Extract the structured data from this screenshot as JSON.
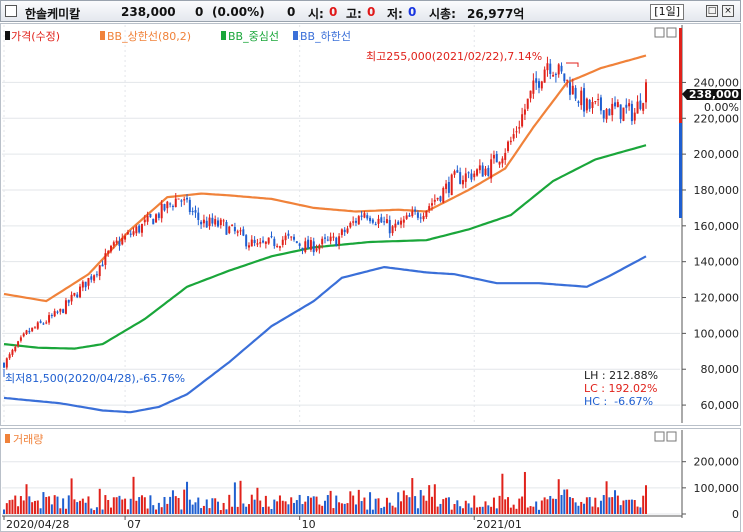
{
  "header": {
    "stock_name": "한솔케미칼",
    "price": "238,000",
    "change": "0",
    "change_pct": "(0.00%)",
    "volume": "0",
    "open_label": "시:",
    "open_value": "0",
    "high_label": "고:",
    "high_value": "0",
    "low_label": "저:",
    "low_value": "0",
    "mcap_label": "시총:",
    "mcap_value": "26,977억",
    "period": "[1일]"
  },
  "legend": {
    "price": "가격(수정)",
    "upper": "BB_상한선(80,2)",
    "middle": "BB_중심선",
    "lower": "BB_하한선"
  },
  "colors": {
    "up": "#e0221b",
    "down": "#1f5fd0",
    "upper_band": "#f0823a",
    "middle_band": "#1aa63a",
    "lower_band": "#3a6fd8",
    "last_price_box": "#111111"
  },
  "annotations": {
    "high": "최고255,000(2021/02/22),7.14%",
    "low": "최저81,500(2020/04/28),-65.76%",
    "lh": "LH : 212.88%",
    "lc": "LC : 192.02%",
    "hc": "HC :  -6.67%"
  },
  "volume_panel": {
    "title": "거래량"
  },
  "chart_data": [
    {
      "type": "line",
      "title": "",
      "y_ticks": [
        "240,000",
        "220,000",
        "200,000",
        "180,000",
        "160,000",
        "140,000",
        "120,000",
        "100,000",
        "80,000",
        "60,000"
      ],
      "y_right_labels": {
        "last_price": "238,000",
        "zero_pct": "0.00%"
      },
      "ylim": [
        50000,
        262000
      ],
      "x_ticks": [
        "2020/04/28",
        "07",
        "10",
        "2021/01"
      ],
      "x_tick_index": [
        0,
        43,
        105,
        167
      ],
      "price_anchors": [
        [
          0,
          83000
        ],
        [
          8,
          100000
        ],
        [
          20,
          112000
        ],
        [
          30,
          130000
        ],
        [
          40,
          150000
        ],
        [
          52,
          163000
        ],
        [
          62,
          176000
        ],
        [
          70,
          162000
        ],
        [
          78,
          160000
        ],
        [
          90,
          148000
        ],
        [
          100,
          153000
        ],
        [
          108,
          148000
        ],
        [
          118,
          152000
        ],
        [
          128,
          168000
        ],
        [
          138,
          158000
        ],
        [
          150,
          170000
        ],
        [
          160,
          186000
        ],
        [
          172,
          192000
        ],
        [
          180,
          207000
        ],
        [
          188,
          236000
        ],
        [
          193,
          252000
        ],
        [
          199,
          242000
        ],
        [
          207,
          226000
        ],
        [
          216,
          225000
        ],
        [
          224,
          223000
        ],
        [
          228,
          238000
        ]
      ],
      "series": [
        {
          "name": "BB_상한선(80,2)",
          "anchors": [
            [
              0,
              122000
            ],
            [
              15,
              118000
            ],
            [
              30,
              133000
            ],
            [
              45,
              158000
            ],
            [
              58,
              176000
            ],
            [
              70,
              178000
            ],
            [
              80,
              177000
            ],
            [
              95,
              175000
            ],
            [
              110,
              170000
            ],
            [
              125,
              168000
            ],
            [
              140,
              169000
            ],
            [
              150,
              168000
            ],
            [
              165,
              180000
            ],
            [
              178,
              192000
            ],
            [
              188,
              215000
            ],
            [
              200,
              240000
            ],
            [
              212,
              248000
            ],
            [
              228,
              255000
            ]
          ]
        },
        {
          "name": "BB_중심선",
          "anchors": [
            [
              0,
              94000
            ],
            [
              12,
              92000
            ],
            [
              25,
              91500
            ],
            [
              35,
              94000
            ],
            [
              50,
              108000
            ],
            [
              65,
              126000
            ],
            [
              80,
              135000
            ],
            [
              95,
              143000
            ],
            [
              110,
              148000
            ],
            [
              130,
              151000
            ],
            [
              150,
              152000
            ],
            [
              165,
              158000
            ],
            [
              180,
              166000
            ],
            [
              195,
              185000
            ],
            [
              210,
              197000
            ],
            [
              228,
              205000
            ]
          ]
        },
        {
          "name": "BB_하한선",
          "anchors": [
            [
              0,
              64000
            ],
            [
              20,
              61000
            ],
            [
              35,
              57000
            ],
            [
              45,
              56000
            ],
            [
              55,
              59000
            ],
            [
              65,
              66000
            ],
            [
              80,
              84000
            ],
            [
              95,
              104000
            ],
            [
              110,
              118000
            ],
            [
              120,
              131000
            ],
            [
              135,
              137000
            ],
            [
              150,
              134000
            ],
            [
              160,
              133000
            ],
            [
              175,
              128000
            ],
            [
              190,
              128000
            ],
            [
              207,
              126000
            ],
            [
              215,
              132000
            ],
            [
              228,
              143000
            ]
          ]
        }
      ]
    },
    {
      "type": "bar",
      "title": "",
      "y_ticks": [
        "200,000",
        "100,000",
        "0"
      ],
      "ylim": [
        0,
        260000
      ],
      "n_bars": 229
    }
  ]
}
